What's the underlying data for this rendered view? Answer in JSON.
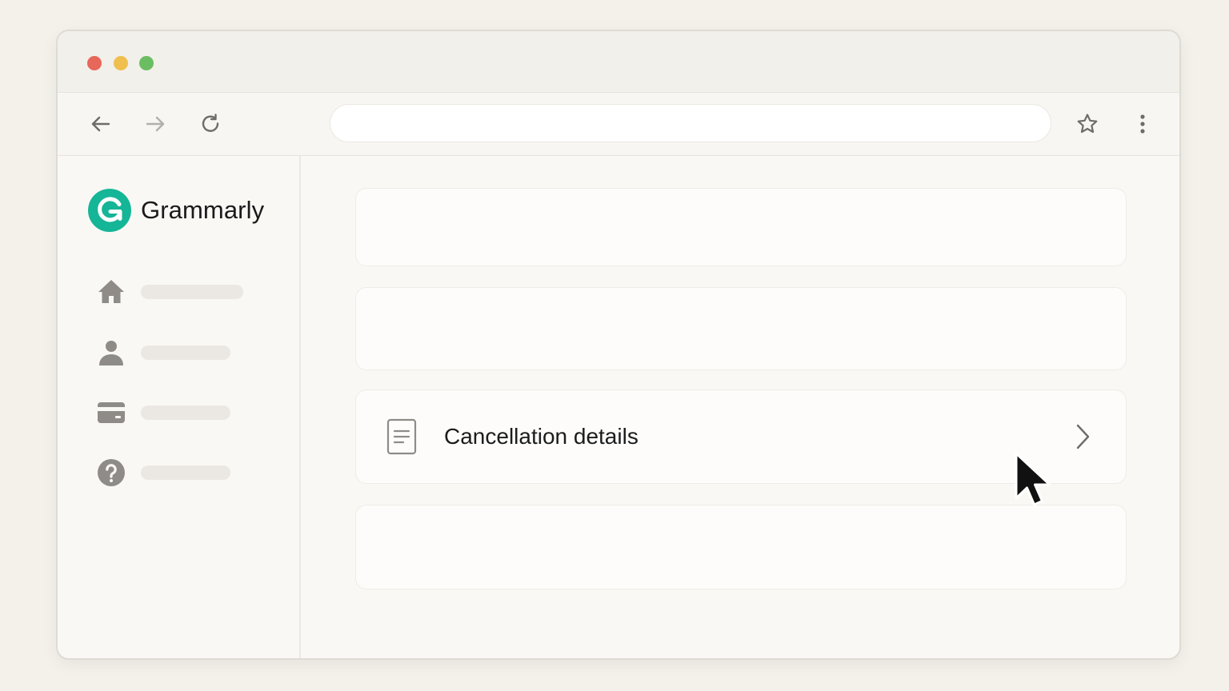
{
  "browser": {
    "address_value": "",
    "icons": {
      "back": "arrow-left-icon",
      "forward": "arrow-right-icon",
      "reload": "reload-icon",
      "bookmark": "star-icon",
      "menu": "more-vertical-icon"
    }
  },
  "sidebar": {
    "brand_name": "Grammarly",
    "brand_color": "#15b597",
    "items": [
      {
        "icon": "home-icon"
      },
      {
        "icon": "user-icon"
      },
      {
        "icon": "credit-card-icon"
      },
      {
        "icon": "help-icon"
      }
    ]
  },
  "main": {
    "cards": [
      {
        "label": ""
      },
      {
        "label": ""
      },
      {
        "label": "Cancellation details",
        "icon": "document-icon"
      },
      {
        "label": ""
      }
    ]
  }
}
